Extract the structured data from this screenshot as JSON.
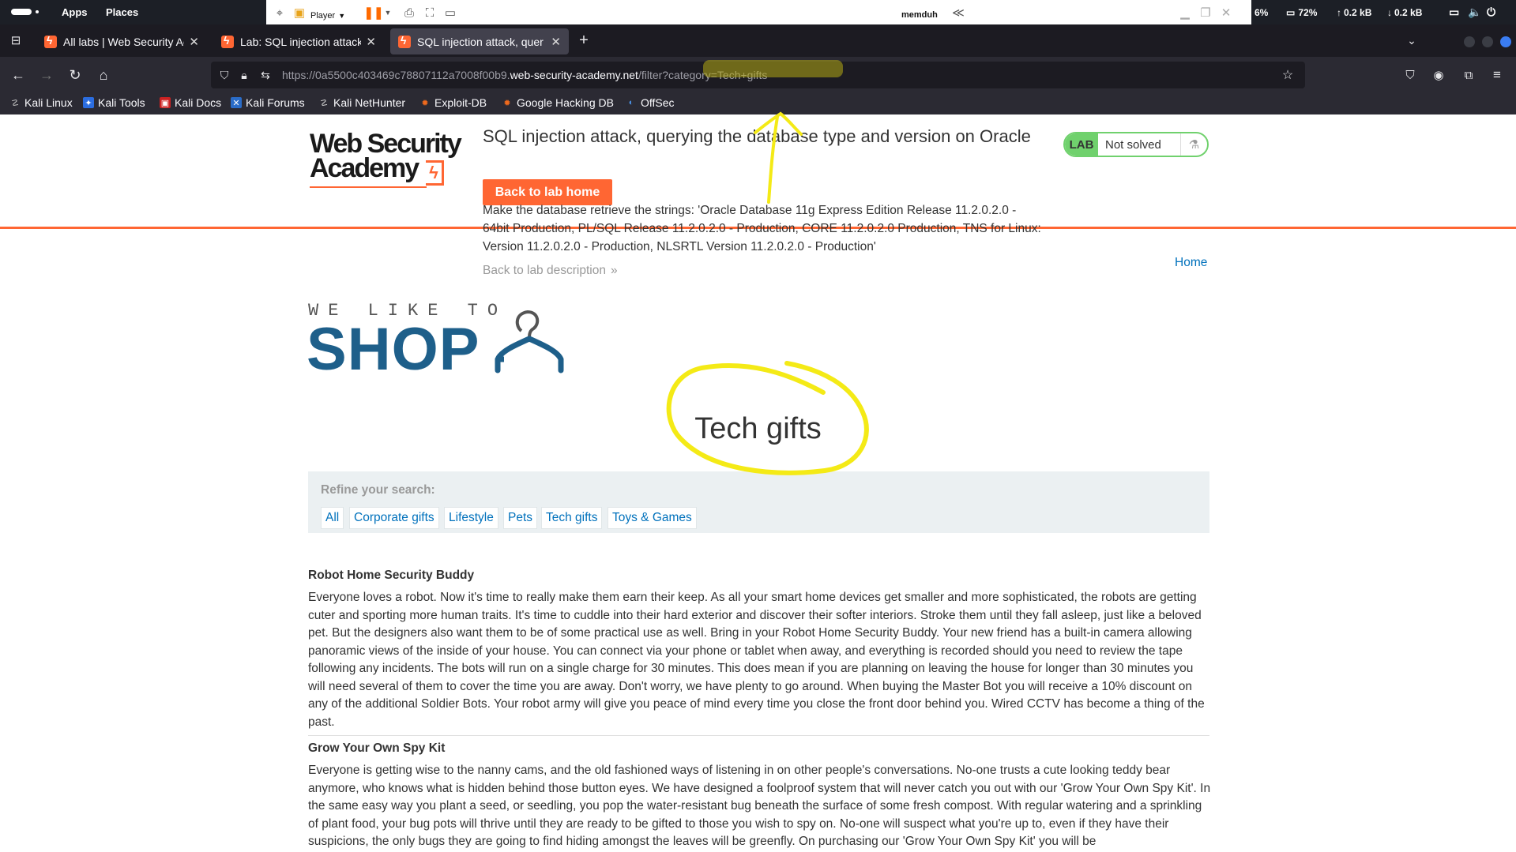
{
  "os": {
    "apps": "Apps",
    "places": "Places",
    "player": "Player",
    "user": "memduh",
    "cpu": "6%",
    "battery": "72%",
    "up": "0.2 kB",
    "down": "0.2 kB"
  },
  "tabs": [
    {
      "title": "All labs | Web Security Ac"
    },
    {
      "title": "Lab: SQL injection attack,"
    },
    {
      "title": "SQL injection attack, quer"
    }
  ],
  "url": {
    "prefix": "https://0a5500c403469c78807112a7008f00b9.",
    "domain": "web-security-academy.net",
    "path": "/filter?category=Tech+gifts"
  },
  "bookmarks": [
    {
      "label": "Kali Linux",
      "icon": "kali-icon"
    },
    {
      "label": "Kali Tools",
      "icon": "kali-tools-icon"
    },
    {
      "label": "Kali Docs",
      "icon": "kali-docs-icon"
    },
    {
      "label": "Kali Forums",
      "icon": "kali-forums-icon"
    },
    {
      "label": "Kali NetHunter",
      "icon": "nethunter-icon"
    },
    {
      "label": "Exploit-DB",
      "icon": "exploitdb-icon"
    },
    {
      "label": "Google Hacking DB",
      "icon": "ghdb-icon"
    },
    {
      "label": "OffSec",
      "icon": "offsec-icon"
    }
  ],
  "lab": {
    "logo_line1": "Web Security",
    "logo_line2": "Academy",
    "title": "SQL injection attack, querying the database type and version on Oracle",
    "back_button": "Back to lab home",
    "objective": "Make the database retrieve the strings: 'Oracle Database 11g Express Edition Release 11.2.0.2.0 - 64bit Production, PL/SQL Release 11.2.0.2.0 - Production, CORE 11.2.0.2.0 Production, TNS for Linux: Version 11.2.0.2.0 - Production, NLSRTL Version 11.2.0.2.0 - Production'",
    "back_desc": "Back to lab description",
    "badge_lab": "LAB",
    "badge_status": "Not solved",
    "home": "Home"
  },
  "shop": {
    "tagline": "WE LIKE TO",
    "name": "SHOP",
    "category_title": "Tech gifts",
    "refine_label": "Refine your search:",
    "filters": [
      "All",
      "Corporate gifts",
      "Lifestyle",
      "Pets",
      "Tech gifts",
      "Toys & Games"
    ]
  },
  "products": [
    {
      "name": "Robot Home Security Buddy",
      "description": "Everyone loves a robot. Now it's time to really make them earn their keep. As all your smart home devices get smaller and more sophisticated, the robots are getting cuter and sporting more human traits. It's time to cuddle into their hard exterior and discover their softer interiors. Stroke them until they fall asleep, just like a beloved pet. But the designers also want them to be of some practical use as well. Bring in your Robot Home Security Buddy. Your new friend has a built-in camera allowing panoramic views of the inside of your house. You can connect via your phone or tablet when away, and everything is recorded should you need to review the tape following any incidents. The bots will run on a single charge for 30 minutes. This does mean if you are planning on leaving the house for longer than 30 minutes you will need several of them to cover the time you are away. Don't worry, we have plenty to go around. When buying the Master Bot you will receive a 10% discount on any of the additional Soldier Bots. Your robot army will give you peace of mind every time you close the front door behind you. Wired CCTV has become a thing of the past."
    },
    {
      "name": "Grow Your Own Spy Kit",
      "description": "Everyone is getting wise to the nanny cams, and the old fashioned ways of listening in on other people's conversations. No-one trusts a cute looking teddy bear anymore, who knows what is hidden behind those button eyes. We have designed a foolproof system that will never catch you out with our 'Grow Your Own Spy Kit'. In the same easy way you plant a seed, or seedling, you pop the water-resistant bug beneath the surface of some fresh compost. With regular watering and a sprinkling of plant food, your bug pots will thrive until they are ready to be gifted to those you wish to spy on. No-one will suspect what you're up to, even if they have their suspicions, the only bugs they are going to find hiding amongst the leaves will be greenfly. On purchasing our 'Grow Your Own Spy Kit' you will be"
    }
  ]
}
